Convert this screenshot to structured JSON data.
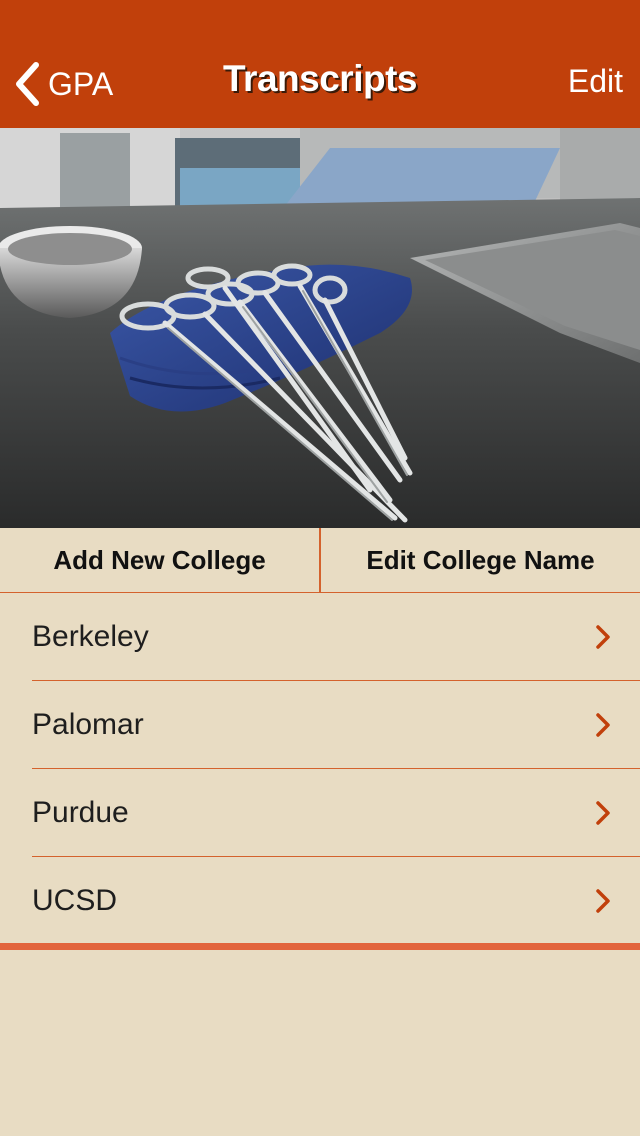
{
  "nav": {
    "back_label": "GPA",
    "title": "Transcripts",
    "edit_label": "Edit"
  },
  "hero": {
    "icon": "surgical-instruments-photo"
  },
  "actions": {
    "add_label": "Add New College",
    "edit_name_label": "Edit College Name"
  },
  "colleges": [
    {
      "name": "Berkeley"
    },
    {
      "name": "Palomar"
    },
    {
      "name": "Purdue"
    },
    {
      "name": "UCSD"
    }
  ],
  "colors": {
    "nav_bg": "#c1400b",
    "accent": "#d4622d",
    "background": "#e8dcc3",
    "chevron": "#c1400b"
  }
}
